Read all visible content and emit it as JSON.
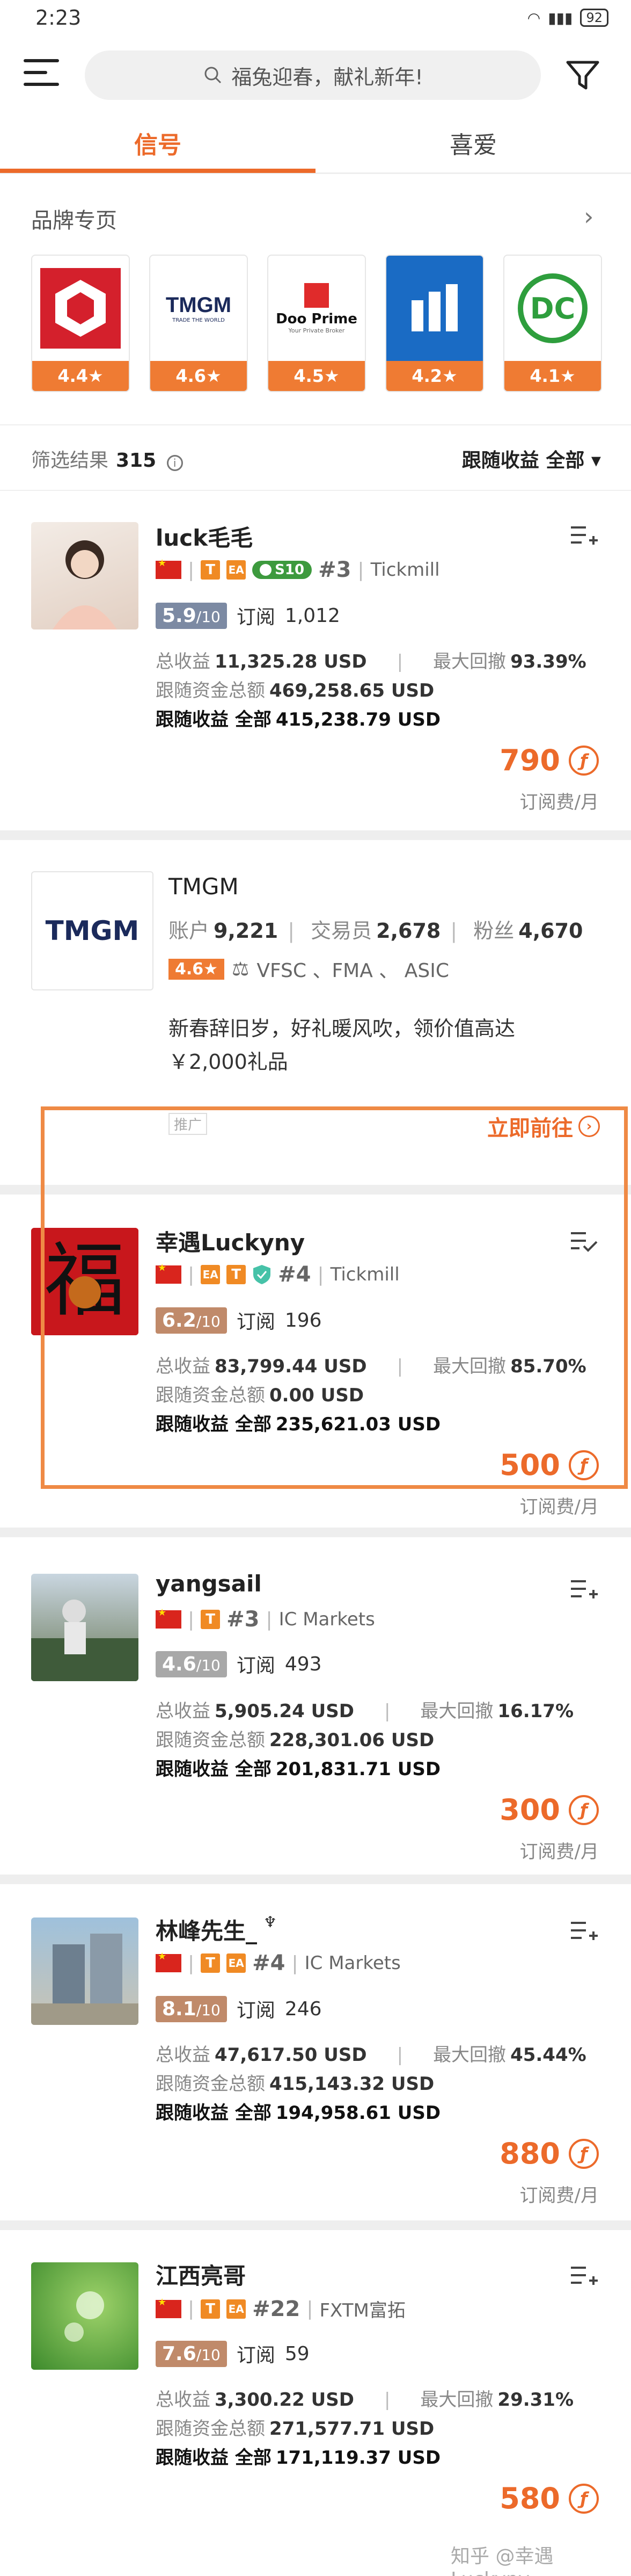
{
  "status_bar": {
    "time": "2:23",
    "battery": "92"
  },
  "search": {
    "placeholder": "福兔迎春，献礼新年!"
  },
  "tabs": [
    {
      "label": "信号"
    },
    {
      "label": "喜爱"
    }
  ],
  "brands": {
    "title": "品牌专页",
    "items": [
      {
        "name": "red-hexagon-brand",
        "rating": "4.4★",
        "color": "#d4202c"
      },
      {
        "name": "TMGM",
        "rating": "4.6★",
        "color": "#1b2a5b"
      },
      {
        "name": "Doo Prime",
        "rating": "4.5★",
        "color": "#e02b2b"
      },
      {
        "name": "blue-bars-brand",
        "rating": "4.2★",
        "color": "#1a6bc4"
      },
      {
        "name": "DC",
        "rating": "4.1★",
        "color": "#2e9e3d"
      }
    ],
    "tmgm_text": "TMGM",
    "tmgm_sub": "TRADE THE WORLD",
    "doo_text": "Doo Prime",
    "doo_sub": "Your Private Broker",
    "dc_text": "DC"
  },
  "results": {
    "label": "筛选结果",
    "count": "315",
    "sort_label": "跟随收益",
    "sort_value": "全部"
  },
  "labels": {
    "subscribe": "订阅",
    "total_profit": "总收益",
    "max_drawdown": "最大回撤",
    "follow_funds": "跟随资金总额",
    "follow_profit": "跟随收益",
    "all": "全部",
    "fee_unit": "订阅费/月",
    "score_suffix": "/10"
  },
  "signals": [
    {
      "name": "luck毛毛",
      "badges": "S10",
      "rank": "#3",
      "broker": "Tickmill",
      "score": "5.9",
      "score_color": "#7c8aa3",
      "subscribers": "1,012",
      "total_profit": "11,325.28 USD",
      "max_drawdown": "93.39%",
      "follow_funds": "469,258.65 USD",
      "follow_profit": "415,238.79 USD",
      "price": "790"
    },
    {
      "name": "幸遇Luckyny",
      "rank": "#4",
      "broker": "Tickmill",
      "score": "6.2",
      "score_color": "#c08a6a",
      "subscribers": "196",
      "total_profit": "83,799.44 USD",
      "max_drawdown": "85.70%",
      "follow_funds": "0.00 USD",
      "follow_profit": "235,621.03 USD",
      "price": "500"
    },
    {
      "name": "yangsail",
      "rank": "#3",
      "broker": "IC Markets",
      "score": "4.6",
      "score_color": "#a8a8a8",
      "subscribers": "493",
      "total_profit": "5,905.24 USD",
      "max_drawdown": "16.17%",
      "follow_funds": "228,301.06 USD",
      "follow_profit": "201,831.71 USD",
      "price": "300"
    },
    {
      "name": "林峰先生_",
      "rank": "#4",
      "broker": "IC Markets",
      "score": "8.1",
      "score_color": "#c08a6a",
      "subscribers": "246",
      "total_profit": "47,617.50 USD",
      "max_drawdown": "45.44%",
      "follow_funds": "415,143.32 USD",
      "follow_profit": "194,958.61 USD",
      "price": "880"
    },
    {
      "name": "江西亮哥",
      "rank": "#22",
      "broker": "FXTM富拓",
      "score": "7.6",
      "score_color": "#c08a6a",
      "subscribers": "59",
      "total_profit": "3,300.22 USD",
      "max_drawdown": "29.31%",
      "follow_funds": "271,577.71 USD",
      "follow_profit": "171,119.37 USD",
      "price": "580"
    }
  ],
  "ad": {
    "name": "TMGM",
    "accounts_label": "账户",
    "accounts": "9,221",
    "traders_label": "交易员",
    "traders": "2,678",
    "fans_label": "粉丝",
    "fans": "4,670",
    "rating": "4.6★",
    "regulators": "VFSC 、FMA 、 ASIC",
    "text": "新春辞旧岁，好礼暖风吹，领价值高达￥2,000礼品",
    "tag": "推广",
    "cta": "立即前往"
  },
  "watermark": "知乎 @幸遇Luckyny"
}
